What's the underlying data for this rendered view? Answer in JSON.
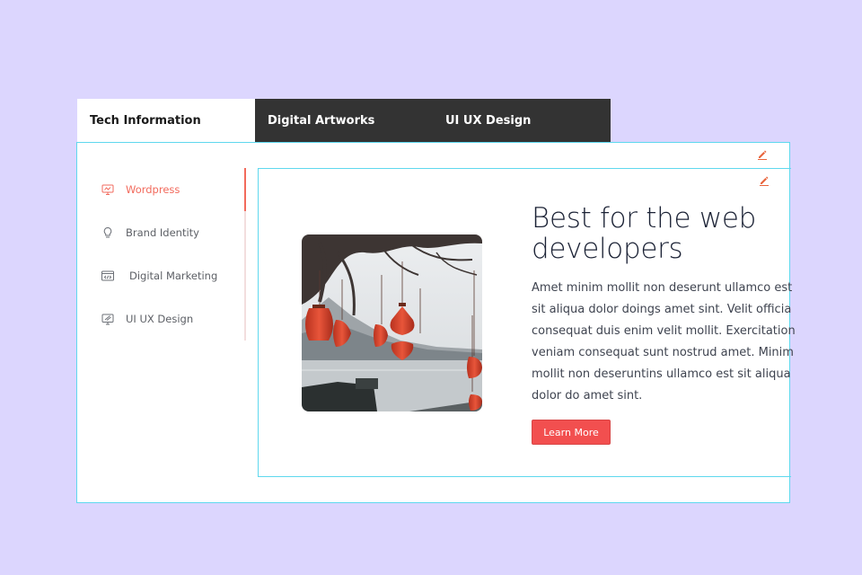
{
  "tabs": [
    {
      "label": "Tech Information",
      "active": true
    },
    {
      "label": "Digital Artworks",
      "active": false
    },
    {
      "label": "UI UX Design",
      "active": false
    }
  ],
  "sidebar": {
    "items": [
      {
        "label": "Wordpress",
        "icon": "monitor-icon",
        "active": true
      },
      {
        "label": "Brand Identity",
        "icon": "lightbulb-icon",
        "active": false
      },
      {
        "label": "Digital Marketing",
        "icon": "code-window-icon",
        "active": false
      },
      {
        "label": "UI UX Design",
        "icon": "palette-screen-icon",
        "active": false
      }
    ]
  },
  "content": {
    "heading_line1": "Best for the web",
    "heading_line2": "developers",
    "body_lines": [
      "Amet minim mollit non deserunt ullamco est",
      "sit aliqua dolor doings amet sint. Velit officia",
      "consequat duis enim velit mollit. Exercitation",
      "veniam consequat sunt nostrud amet. Minim",
      "mollit non deseruntins ullamco est sit aliqua",
      "dolor do amet sint."
    ],
    "button_label": "Learn More",
    "image": "red-paper-lanterns-photo"
  },
  "colors": {
    "background": "#dcd6fe",
    "accent": "#f26a5c",
    "button": "#f24f4f",
    "tab_dark": "#333333",
    "outline": "#5fd8ee"
  }
}
